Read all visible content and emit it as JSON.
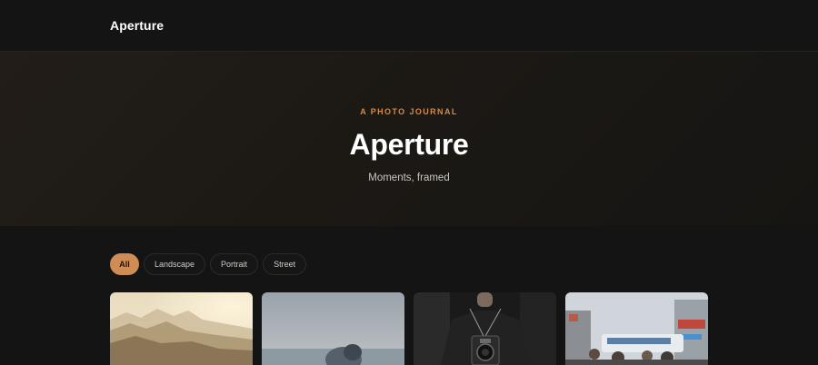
{
  "header": {
    "brand": "Aperture"
  },
  "hero": {
    "eyebrow": "A PHOTO JOURNAL",
    "title": "Aperture",
    "tagline": "Moments, framed"
  },
  "filters": [
    {
      "label": "All",
      "active": true
    },
    {
      "label": "Landscape",
      "active": false
    },
    {
      "label": "Portrait",
      "active": false
    },
    {
      "label": "Street",
      "active": false
    }
  ],
  "gallery": [
    {
      "subject": "misty mountain landscape"
    },
    {
      "subject": "seaside portrait"
    },
    {
      "subject": "person holding camera"
    },
    {
      "subject": "busy street scene"
    }
  ],
  "colors": {
    "accent": "#cf8c55",
    "background": "#141414",
    "hero_background": "#1e1a16"
  }
}
